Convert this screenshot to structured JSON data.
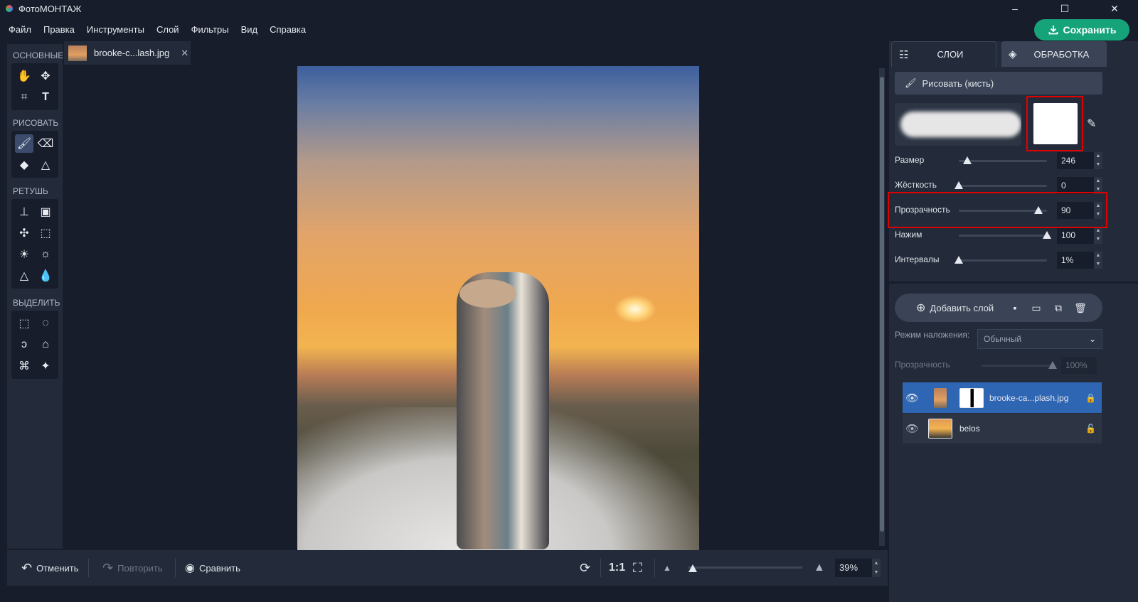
{
  "app": {
    "title": "ФотоМОНТАЖ"
  },
  "window": {
    "minimize": "–",
    "maximize": "☐",
    "close": "✕"
  },
  "menu": [
    "Файл",
    "Правка",
    "Инструменты",
    "Слой",
    "Фильтры",
    "Вид",
    "Справка"
  ],
  "save_button": "Сохранить",
  "tools": {
    "sections": [
      "ОСНОВНЫЕ",
      "РИСОВАТЬ",
      "РЕТУШЬ",
      "ВЫДЕЛИТЬ"
    ]
  },
  "tab": {
    "filename": "brooke-c...lash.jpg",
    "close": "✕"
  },
  "bottom": {
    "undo": "Отменить",
    "redo": "Повторить",
    "compare": "Сравнить",
    "ratio": "1:1",
    "zoom": "39%"
  },
  "right_panel": {
    "tabs": [
      "СЛОИ",
      "ОБРАБОТКА"
    ],
    "draw_button": "Рисовать (кисть)",
    "params": [
      {
        "label": "Размер",
        "value": "246",
        "fraction": 0.1
      },
      {
        "label": "Жёсткость",
        "value": "0",
        "fraction": 0.0
      },
      {
        "label": "Прозрачность",
        "value": "90",
        "fraction": 0.9
      },
      {
        "label": "Нажим",
        "value": "100",
        "fraction": 1.0
      },
      {
        "label": "Интервалы",
        "value": "1%",
        "fraction": 0.0
      }
    ],
    "add_layer": "Добавить слой",
    "blend_label": "Режим наложения:",
    "blend_value": "Обычный",
    "opacity_label": "Прозрачность",
    "opacity_value": "100%",
    "layers": [
      {
        "name": "brooke-ca...plash.jpg",
        "selected": true
      },
      {
        "name": "belos",
        "selected": false
      }
    ]
  },
  "colors": {
    "accent": "#16a37a",
    "selected_layer": "#2f66b3",
    "highlight": "#e00000"
  }
}
